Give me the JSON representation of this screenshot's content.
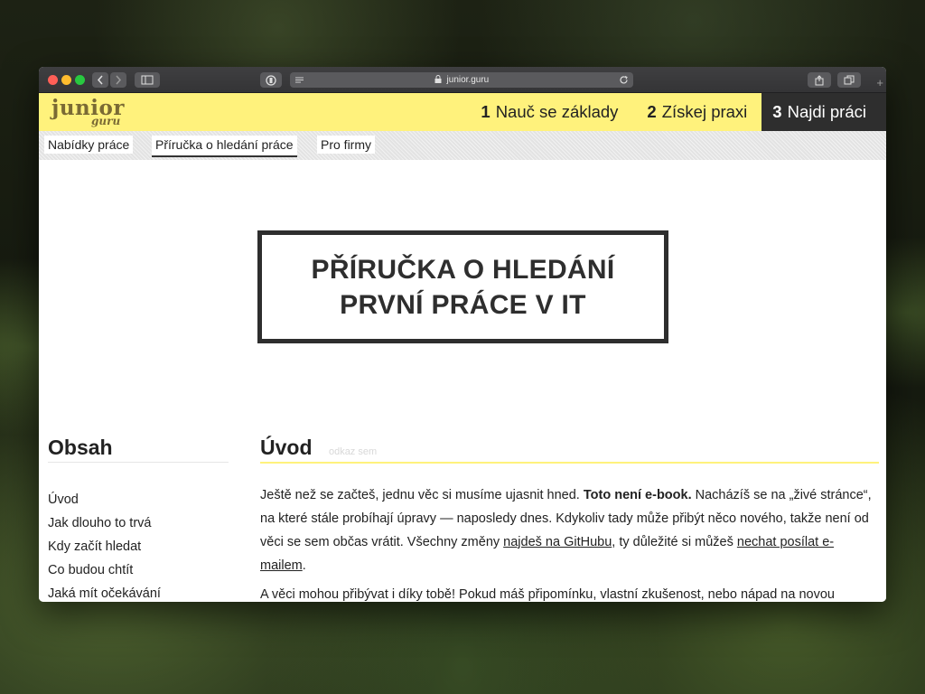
{
  "browser": {
    "url": "junior.guru",
    "new_tab_symbol": "+"
  },
  "site": {
    "logo_main": "junior",
    "logo_sub": "guru",
    "steps": [
      {
        "num": "1",
        "label": "Nauč se základy"
      },
      {
        "num": "2",
        "label": "Získej praxi"
      },
      {
        "num": "3",
        "label": "Najdi práci"
      }
    ]
  },
  "subnav": {
    "tabs": [
      "Nabídky práce",
      "Příručka o hledání práce",
      "Pro firmy"
    ]
  },
  "hero": {
    "line1": "PŘÍRUČKA O HLEDÁNÍ",
    "line2": "PRVNÍ PRÁCE V IT"
  },
  "toc": {
    "title": "Obsah",
    "items": [
      "Úvod",
      "Jak dlouho to trvá",
      "Kdy začít hledat",
      "Co budou chtít",
      "Jaká mít očekávání"
    ]
  },
  "article": {
    "title": "Úvod",
    "anchor": "odkaz sem",
    "p1_a": "Ještě než se začteš, jednu věc si musíme ujasnit hned. ",
    "p1_bold": "Toto není e-book.",
    "p1_b": " Nacházíš se na „živé stránce“, na které stále probíhají úpravy — naposledy dnes. Kdykoliv tady může přibýt něco nového, takže není od věci se sem občas vrátit. Všechny změny ",
    "p1_link1": "najdeš na GitHubu",
    "p1_c": ", ty důležité si můžeš ",
    "p1_link2": "nechat posílat e-mailem",
    "p1_d": ".",
    "p2": "A věci mohou přibývat i díky tobě! Pokud máš připomínku, vlastní zkušenost, nebo nápad na novou"
  }
}
